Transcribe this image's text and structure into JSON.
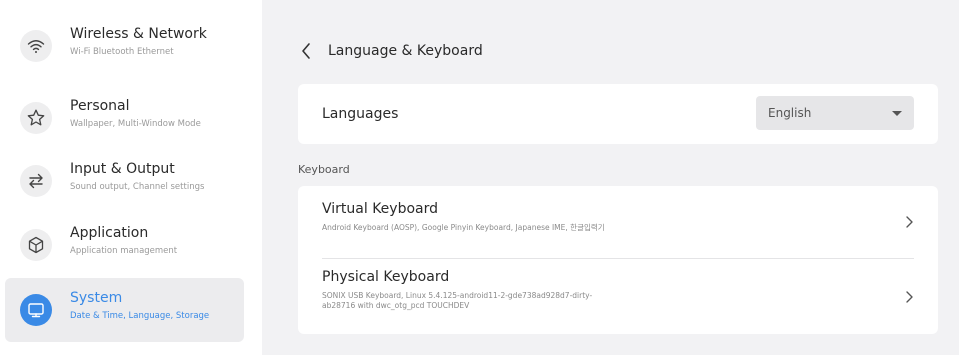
{
  "sidebar": {
    "items": [
      {
        "label": "Wireless & Network",
        "subtitle": "Wi-Fi Bluetooth Ethernet",
        "icon": "wifi-icon"
      },
      {
        "label": "Personal",
        "subtitle": "Wallpaper, Multi-Window Mode",
        "icon": "star-icon"
      },
      {
        "label": "Input & Output",
        "subtitle": "Sound output, Channel settings",
        "icon": "swap-arrows-icon"
      },
      {
        "label": "Application",
        "subtitle": "Application management",
        "icon": "cube-icon"
      },
      {
        "label": "System",
        "subtitle": "Date & Time, Language, Storage",
        "icon": "monitor-icon",
        "active": true
      }
    ]
  },
  "main": {
    "title": "Language & Keyboard",
    "languages": {
      "label": "Languages",
      "selected": "English"
    },
    "keyboard_section": "Keyboard",
    "keyboards": [
      {
        "title": "Virtual Keyboard",
        "description": "Android Keyboard (AOSP), Google Pinyin Keyboard, Japanese IME, 한글입력기"
      },
      {
        "title": "Physical Keyboard",
        "description": "SONIX USB Keyboard, Linux 5.4.125-android11-2-gde738ad928d7-dirty-ab28716 with dwc_otg_pcd TOUCHDEV"
      }
    ]
  },
  "colors": {
    "accent": "#3a8ae6",
    "background": "#f2f2f4",
    "card": "#ffffff"
  }
}
